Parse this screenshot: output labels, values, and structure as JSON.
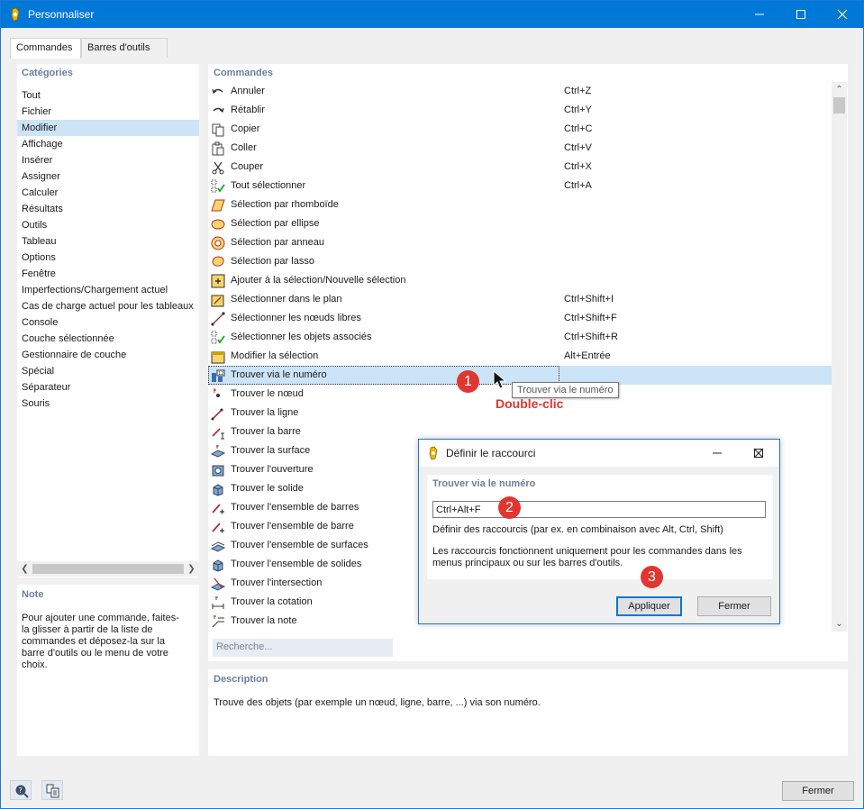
{
  "window": {
    "title": "Personnaliser",
    "controls": [
      "minimize",
      "maximize",
      "close"
    ]
  },
  "tabs": [
    {
      "label": "Commandes",
      "active": true
    },
    {
      "label": "Barres d'outils",
      "active": false
    }
  ],
  "categories": {
    "header": "Catégories",
    "selected": "Modifier",
    "items": [
      "Tout",
      "Fichier",
      "Modifier",
      "Affichage",
      "Insérer",
      "Assigner",
      "Calculer",
      "Résultats",
      "Outils",
      "Tableau",
      "Options",
      "Fenêtre",
      "Imperfections/Chargement actuel",
      "Cas de charge actuel pour les tableaux",
      "Console",
      "Couche sélectionnée",
      "Gestionnaire de couche",
      "Spécial",
      "Séparateur",
      "Souris"
    ]
  },
  "note": {
    "header": "Note",
    "lines": [
      "Pour ajouter une commande, faites-",
      "la glisser à partir de la liste de",
      "commandes et déposez-la sur la",
      "barre d'outils ou le menu de votre",
      "choix."
    ]
  },
  "commands": {
    "header": "Commandes",
    "selected": "Trouver via le numéro",
    "items": [
      {
        "label": "Annuler",
        "shortcut": "Ctrl+Z",
        "icon": "undo-icon"
      },
      {
        "label": "Rétablir",
        "shortcut": "Ctrl+Y",
        "icon": "redo-icon"
      },
      {
        "label": "Copier",
        "shortcut": "Ctrl+C",
        "icon": "copy-icon"
      },
      {
        "label": "Coller",
        "shortcut": "Ctrl+V",
        "icon": "paste-icon"
      },
      {
        "label": "Couper",
        "shortcut": "Ctrl+X",
        "icon": "cut-icon"
      },
      {
        "label": "Tout sélectionner",
        "shortcut": "Ctrl+A",
        "icon": "select-all-icon"
      },
      {
        "label": "Sélection par rhomboïde",
        "shortcut": "",
        "icon": "rhomboid-select-icon"
      },
      {
        "label": "Sélection par ellipse",
        "shortcut": "",
        "icon": "ellipse-select-icon"
      },
      {
        "label": "Sélection par anneau",
        "shortcut": "",
        "icon": "ring-select-icon"
      },
      {
        "label": "Sélection par lasso",
        "shortcut": "",
        "icon": "lasso-select-icon"
      },
      {
        "label": "Ajouter à la sélection/Nouvelle sélection",
        "shortcut": "",
        "icon": "add-selection-icon"
      },
      {
        "label": "Sélectionner dans le plan",
        "shortcut": "Ctrl+Shift+I",
        "icon": "plane-select-icon"
      },
      {
        "label": "Sélectionner les nœuds libres",
        "shortcut": "Ctrl+Shift+F",
        "icon": "free-nodes-icon"
      },
      {
        "label": "Sélectionner les objets associés",
        "shortcut": "Ctrl+Shift+R",
        "icon": "related-objects-icon"
      },
      {
        "label": "Modifier la sélection",
        "shortcut": "Alt+Entrée",
        "icon": "edit-selection-icon"
      },
      {
        "label": "Trouver via le numéro",
        "shortcut": "",
        "icon": "find-number-icon"
      },
      {
        "label": "Trouver le nœud",
        "shortcut": "",
        "icon": "find-node-icon"
      },
      {
        "label": "Trouver la ligne",
        "shortcut": "",
        "icon": "find-line-icon"
      },
      {
        "label": "Trouver la barre",
        "shortcut": "",
        "icon": "find-member-icon"
      },
      {
        "label": "Trouver la surface",
        "shortcut": "",
        "icon": "find-surface-icon"
      },
      {
        "label": "Trouver l'ouverture",
        "shortcut": "",
        "icon": "find-opening-icon"
      },
      {
        "label": "Trouver le solide",
        "shortcut": "",
        "icon": "find-solid-icon"
      },
      {
        "label": "Trouver l'ensemble de barres",
        "shortcut": "",
        "icon": "find-member-set-icon"
      },
      {
        "label": "Trouver l'ensemble de barre",
        "shortcut": "",
        "icon": "find-member-set-2-icon"
      },
      {
        "label": "Trouver l'ensemble de surfaces",
        "shortcut": "",
        "icon": "find-surface-set-icon"
      },
      {
        "label": "Trouver l'ensemble de solides",
        "shortcut": "",
        "icon": "find-solid-set-icon"
      },
      {
        "label": "Trouver l'intersection",
        "shortcut": "",
        "icon": "find-intersection-icon"
      },
      {
        "label": "Trouver la cotation",
        "shortcut": "",
        "icon": "find-dimension-icon"
      },
      {
        "label": "Trouver la note",
        "shortcut": "",
        "icon": "find-note-icon"
      }
    ]
  },
  "search": {
    "placeholder": "Recherche..."
  },
  "tooltip": {
    "text": "Trouver via le numéro"
  },
  "annotations": {
    "badge1": "1",
    "badge2": "2",
    "badge3": "3",
    "double_click": "Double-clic",
    "color": "#e0362f"
  },
  "dialog": {
    "title": "Définir le raccourci",
    "command_name": "Trouver via le numéro",
    "shortcut_value": "Ctrl+Alt+F",
    "hint": "Définir des raccourcis (par ex. en combinaison avec Alt, Ctrl, Shift)",
    "info_line1": "Les raccourcis fonctionnent uniquement pour les commandes dans les",
    "info_line2": "menus principaux ou sur les barres d'outils.",
    "apply_label": "Appliquer",
    "close_label": "Fermer"
  },
  "description": {
    "header": "Description",
    "text": "Trouve des objets (par exemple un nœud, ligne, barre, ...) via son numéro."
  },
  "footer": {
    "close_label": "Fermer"
  },
  "colors": {
    "accent": "#0078d7",
    "selection": "#cce4f7",
    "header_text": "#6b7f9a"
  }
}
